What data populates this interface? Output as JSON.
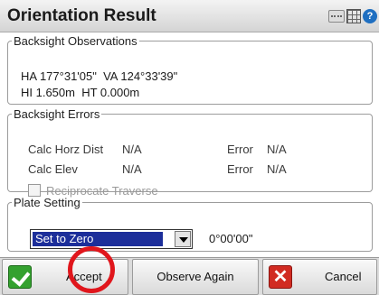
{
  "window": {
    "title": "Orientation Result",
    "icons": [
      "keyboard-icon",
      "grid-icon",
      "help-icon"
    ]
  },
  "backsight_observations": {
    "legend": "Backsight Observations",
    "line1": "HA 177°31'05\"  VA 124°33'39\"",
    "line2": "HI 1.650m  HT 0.000m"
  },
  "backsight_errors": {
    "legend": "Backsight Errors",
    "calc_horz_dist_label": "Calc Horz Dist",
    "calc_horz_dist_value": "N/A",
    "error1_label": "Error",
    "error1_value": "N/A",
    "calc_elev_label": "Calc Elev",
    "calc_elev_value": "N/A",
    "error2_label": "Error",
    "error2_value": "N/A",
    "reciprocate_label": "Reciprocate Traverse",
    "reciprocate_checked": false
  },
  "plate_setting": {
    "legend": "Plate Setting",
    "selected": "Set to Zero",
    "value": "0°00'00\""
  },
  "buttons": {
    "accept_label": "Accept",
    "observe_again_label": "Observe Again",
    "cancel_label": "Cancel"
  },
  "colors": {
    "accent_select": "#1c2e9a",
    "accept_icon": "#34a12f",
    "cancel_icon": "#d12b22",
    "highlight_circle": "#e0161c"
  }
}
